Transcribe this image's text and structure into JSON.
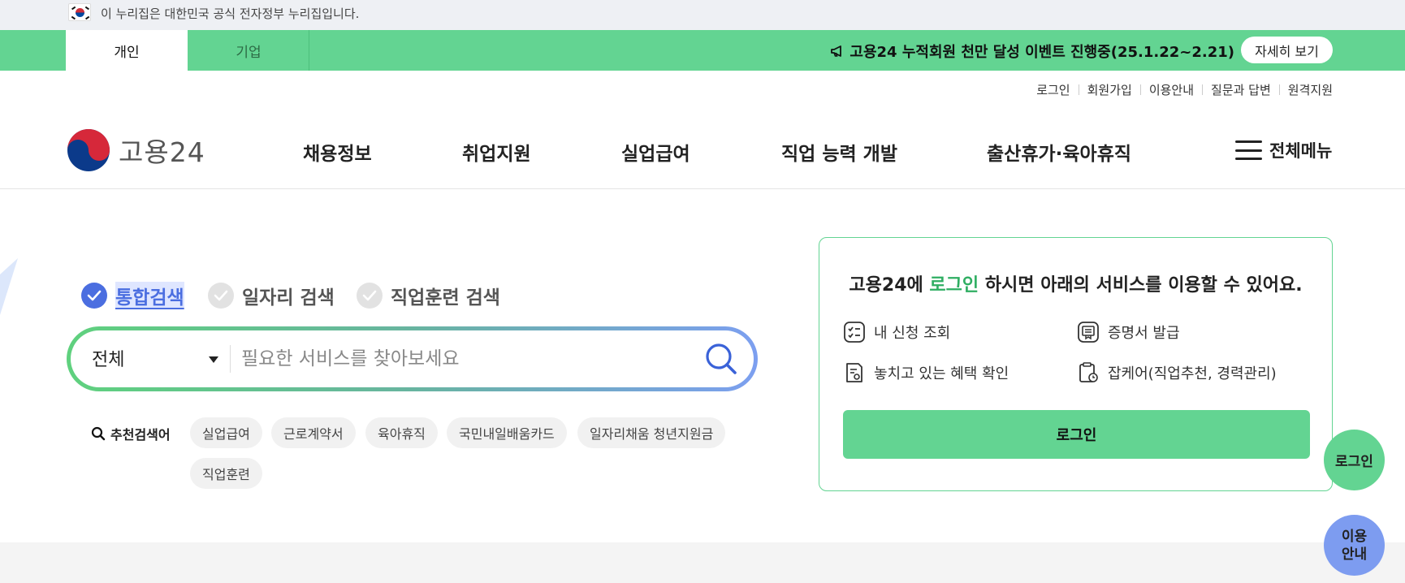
{
  "gov_notice": {
    "text": "이 누리집은 대한민국 공식 전자정부 누리집입니다."
  },
  "top_tabs": {
    "personal": "개인",
    "business": "기업"
  },
  "event": {
    "text": "고용24 누적회원 천만 달성 이벤트 진행중(25.1.22~2.21)",
    "button": "자세히 보기"
  },
  "util_links": [
    "로그인",
    "회원가입",
    "이용안내",
    "질문과 답변",
    "원격지원"
  ],
  "logo": {
    "text": "고용24"
  },
  "nav": [
    "채용정보",
    "취업지원",
    "실업급여",
    "직업 능력 개발",
    "출산휴가·육아휴직"
  ],
  "all_menu": "전체메뉴",
  "search": {
    "tabs": [
      "통합검색",
      "일자리 검색",
      "직업훈련 검색"
    ],
    "select_value": "전체",
    "placeholder": "필요한 서비스를 찾아보세요",
    "rec_label": "추천검색어",
    "keywords": [
      "실업급여",
      "근로계약서",
      "육아휴직",
      "국민내일배움카드",
      "일자리채움 청년지원금",
      "직업훈련"
    ]
  },
  "login_panel": {
    "title_pre": "고용24에 ",
    "title_green": "로그인",
    "title_post": " 하시면 아래의 서비스를 이용할 수 있어요.",
    "services": [
      "내 신청 조회",
      "증명서 발급",
      "놓치고 있는 혜택 확인",
      "잡케어(직업추천, 경력관리)"
    ],
    "button": "로그인"
  },
  "floating": {
    "login": "로그인",
    "guide_line1": "이용",
    "guide_line2": "안내"
  },
  "colors": {
    "brand_green": "#63d492",
    "accent_blue": "#4b6ee0"
  }
}
